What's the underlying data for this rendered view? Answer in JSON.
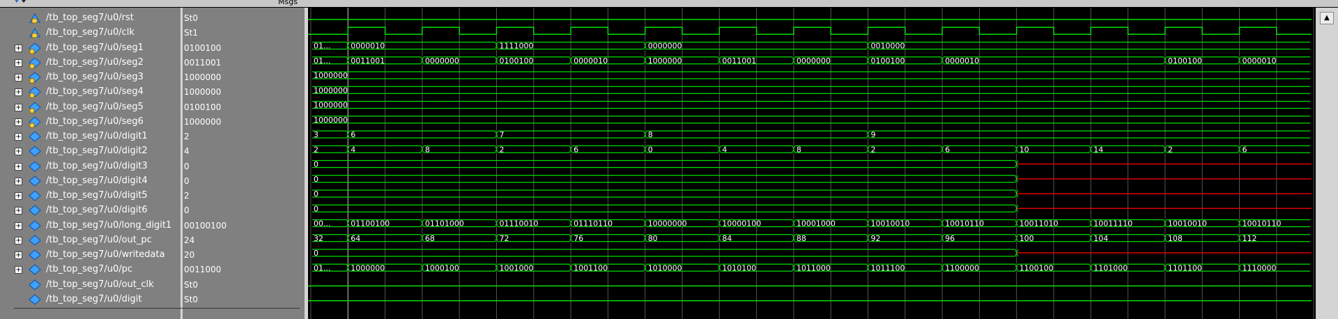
{
  "header": {
    "msgs_label": "Msgs"
  },
  "colors": {
    "wave": "#00e000",
    "undefined": "#e00000",
    "grid": "#555555",
    "cursor": "#b8b8b8"
  },
  "signals": [
    {
      "name": "/tb_top_seg7/u0/rst",
      "value": "St0",
      "kind": "bit",
      "expandable": false,
      "icon": "input-port-icon"
    },
    {
      "name": "/tb_top_seg7/u0/clk",
      "value": "St1",
      "kind": "bit",
      "expandable": false,
      "icon": "input-port-icon"
    },
    {
      "name": "/tb_top_seg7/u0/seg1",
      "value": "0100100",
      "kind": "bus",
      "expandable": true,
      "icon": "output-bus-icon"
    },
    {
      "name": "/tb_top_seg7/u0/seg2",
      "value": "0011001",
      "kind": "bus",
      "expandable": true,
      "icon": "output-bus-icon"
    },
    {
      "name": "/tb_top_seg7/u0/seg3",
      "value": "1000000",
      "kind": "bus",
      "expandable": true,
      "icon": "output-bus-icon"
    },
    {
      "name": "/tb_top_seg7/u0/seg4",
      "value": "1000000",
      "kind": "bus",
      "expandable": true,
      "icon": "output-bus-icon"
    },
    {
      "name": "/tb_top_seg7/u0/seg5",
      "value": "0100100",
      "kind": "bus",
      "expandable": true,
      "icon": "output-bus-icon"
    },
    {
      "name": "/tb_top_seg7/u0/seg6",
      "value": "1000000",
      "kind": "bus",
      "expandable": true,
      "icon": "output-bus-icon"
    },
    {
      "name": "/tb_top_seg7/u0/digit1",
      "value": "2",
      "kind": "bus",
      "expandable": true,
      "icon": "internal-bus-icon"
    },
    {
      "name": "/tb_top_seg7/u0/digit2",
      "value": "4",
      "kind": "bus",
      "expandable": true,
      "icon": "internal-bus-icon"
    },
    {
      "name": "/tb_top_seg7/u0/digit3",
      "value": "0",
      "kind": "bus",
      "expandable": true,
      "icon": "internal-bus-icon"
    },
    {
      "name": "/tb_top_seg7/u0/digit4",
      "value": "0",
      "kind": "bus",
      "expandable": true,
      "icon": "internal-bus-icon"
    },
    {
      "name": "/tb_top_seg7/u0/digit5",
      "value": "2",
      "kind": "bus",
      "expandable": true,
      "icon": "internal-bus-icon"
    },
    {
      "name": "/tb_top_seg7/u0/digit6",
      "value": "0",
      "kind": "bus",
      "expandable": true,
      "icon": "internal-bus-icon"
    },
    {
      "name": "/tb_top_seg7/u0/long_digit1",
      "value": "00100100",
      "kind": "bus",
      "expandable": true,
      "icon": "internal-bus-icon"
    },
    {
      "name": "/tb_top_seg7/u0/out_pc",
      "value": "24",
      "kind": "bus",
      "expandable": true,
      "icon": "internal-bus-icon"
    },
    {
      "name": "/tb_top_seg7/u0/writedata",
      "value": "20",
      "kind": "bus",
      "expandable": true,
      "icon": "internal-bus-icon"
    },
    {
      "name": "/tb_top_seg7/u0/pc",
      "value": "0011000",
      "kind": "bus",
      "expandable": true,
      "icon": "internal-bus-icon"
    },
    {
      "name": "/tb_top_seg7/u0/out_clk",
      "value": "St0",
      "kind": "bit",
      "expandable": false,
      "icon": "internal-bit-icon"
    },
    {
      "name": "/tb_top_seg7/u0/digit",
      "value": "St0",
      "kind": "bit",
      "expandable": false,
      "icon": "internal-bit-icon"
    }
  ],
  "waveforms": {
    "clock_period_units": 1,
    "rows": [
      {
        "type": "low"
      },
      {
        "type": "clock",
        "start_level": "low"
      },
      {
        "type": "bus",
        "segments": [
          {
            "t": 0,
            "label": "01..."
          },
          {
            "t": 0.5,
            "label": "0000010"
          },
          {
            "t": 2.5,
            "label": "1111000"
          },
          {
            "t": 4.5,
            "label": "0000000"
          },
          {
            "t": 7.5,
            "label": "0010000"
          }
        ]
      },
      {
        "type": "bus",
        "segments": [
          {
            "t": 0,
            "label": "01..."
          },
          {
            "t": 0.5,
            "label": "0011001"
          },
          {
            "t": 1.5,
            "label": "0000000"
          },
          {
            "t": 2.5,
            "label": "0100100"
          },
          {
            "t": 3.5,
            "label": "0000010"
          },
          {
            "t": 4.5,
            "label": "1000000"
          },
          {
            "t": 5.5,
            "label": "0011001"
          },
          {
            "t": 6.5,
            "label": "0000000"
          },
          {
            "t": 7.5,
            "label": "0100100"
          },
          {
            "t": 8.5,
            "label": "0000010"
          },
          {
            "t": 11.5,
            "label": "0100100"
          },
          {
            "t": 12.5,
            "label": "0000010"
          }
        ]
      },
      {
        "type": "bus",
        "segments": [
          {
            "t": 0,
            "label": "1000000"
          }
        ]
      },
      {
        "type": "bus",
        "segments": [
          {
            "t": 0,
            "label": "1000000"
          }
        ]
      },
      {
        "type": "bus",
        "segments": [
          {
            "t": 0,
            "label": "1000000"
          }
        ]
      },
      {
        "type": "bus",
        "segments": [
          {
            "t": 0,
            "label": "1000000"
          }
        ]
      },
      {
        "type": "bus",
        "segments": [
          {
            "t": 0,
            "label": "3"
          },
          {
            "t": 0.5,
            "label": "6"
          },
          {
            "t": 2.5,
            "label": "7"
          },
          {
            "t": 4.5,
            "label": "8"
          },
          {
            "t": 7.5,
            "label": "9"
          }
        ]
      },
      {
        "type": "bus",
        "segments": [
          {
            "t": 0,
            "label": "2"
          },
          {
            "t": 0.5,
            "label": "4"
          },
          {
            "t": 1.5,
            "label": "8"
          },
          {
            "t": 2.5,
            "label": "2"
          },
          {
            "t": 3.5,
            "label": "6"
          },
          {
            "t": 4.5,
            "label": "0"
          },
          {
            "t": 5.5,
            "label": "4"
          },
          {
            "t": 6.5,
            "label": "8"
          },
          {
            "t": 7.5,
            "label": "2"
          },
          {
            "t": 8.5,
            "label": "6"
          },
          {
            "t": 9.5,
            "label": "10"
          },
          {
            "t": 10.5,
            "label": "14"
          },
          {
            "t": 11.5,
            "label": "2"
          },
          {
            "t": 12.5,
            "label": "6"
          }
        ]
      },
      {
        "type": "bus",
        "segments": [
          {
            "t": 0,
            "label": "0"
          },
          {
            "t": 9.5,
            "label": "",
            "undefined": true
          }
        ]
      },
      {
        "type": "bus",
        "segments": [
          {
            "t": 0,
            "label": "0"
          },
          {
            "t": 9.5,
            "label": "",
            "undefined": true
          }
        ]
      },
      {
        "type": "bus",
        "segments": [
          {
            "t": 0,
            "label": "0"
          },
          {
            "t": 9.5,
            "label": "",
            "undefined": true
          }
        ]
      },
      {
        "type": "bus",
        "segments": [
          {
            "t": 0,
            "label": "0"
          },
          {
            "t": 9.5,
            "label": "",
            "undefined": true
          }
        ]
      },
      {
        "type": "bus",
        "segments": [
          {
            "t": 0,
            "label": "00..."
          },
          {
            "t": 0.5,
            "label": "01100100"
          },
          {
            "t": 1.5,
            "label": "01101000"
          },
          {
            "t": 2.5,
            "label": "01110010"
          },
          {
            "t": 3.5,
            "label": "01110110"
          },
          {
            "t": 4.5,
            "label": "10000000"
          },
          {
            "t": 5.5,
            "label": "10000100"
          },
          {
            "t": 6.5,
            "label": "10001000"
          },
          {
            "t": 7.5,
            "label": "10010010"
          },
          {
            "t": 8.5,
            "label": "10010110"
          },
          {
            "t": 9.5,
            "label": "10011010"
          },
          {
            "t": 10.5,
            "label": "10011110"
          },
          {
            "t": 11.5,
            "label": "10010010"
          },
          {
            "t": 12.5,
            "label": "10010110"
          }
        ]
      },
      {
        "type": "bus",
        "segments": [
          {
            "t": 0,
            "label": "32"
          },
          {
            "t": 0.5,
            "label": "64"
          },
          {
            "t": 1.5,
            "label": "68"
          },
          {
            "t": 2.5,
            "label": "72"
          },
          {
            "t": 3.5,
            "label": "76"
          },
          {
            "t": 4.5,
            "label": "80"
          },
          {
            "t": 5.5,
            "label": "84"
          },
          {
            "t": 6.5,
            "label": "88"
          },
          {
            "t": 7.5,
            "label": "92"
          },
          {
            "t": 8.5,
            "label": "96"
          },
          {
            "t": 9.5,
            "label": "100"
          },
          {
            "t": 10.5,
            "label": "104"
          },
          {
            "t": 11.5,
            "label": "108"
          },
          {
            "t": 12.5,
            "label": "112"
          }
        ]
      },
      {
        "type": "bus",
        "segments": [
          {
            "t": 0,
            "label": "0"
          },
          {
            "t": 9.5,
            "label": "",
            "undefined": true
          }
        ]
      },
      {
        "type": "bus",
        "segments": [
          {
            "t": 0,
            "label": "01..."
          },
          {
            "t": 0.5,
            "label": "1000000"
          },
          {
            "t": 1.5,
            "label": "1000100"
          },
          {
            "t": 2.5,
            "label": "1001000"
          },
          {
            "t": 3.5,
            "label": "1001100"
          },
          {
            "t": 4.5,
            "label": "1010000"
          },
          {
            "t": 5.5,
            "label": "1010100"
          },
          {
            "t": 6.5,
            "label": "1011000"
          },
          {
            "t": 7.5,
            "label": "1011100"
          },
          {
            "t": 8.5,
            "label": "1100000"
          },
          {
            "t": 9.5,
            "label": "1100100"
          },
          {
            "t": 10.5,
            "label": "1101000"
          },
          {
            "t": 11.5,
            "label": "1101100"
          },
          {
            "t": 12.5,
            "label": "1110000"
          }
        ]
      },
      {
        "type": "low"
      },
      {
        "type": "low"
      }
    ]
  }
}
